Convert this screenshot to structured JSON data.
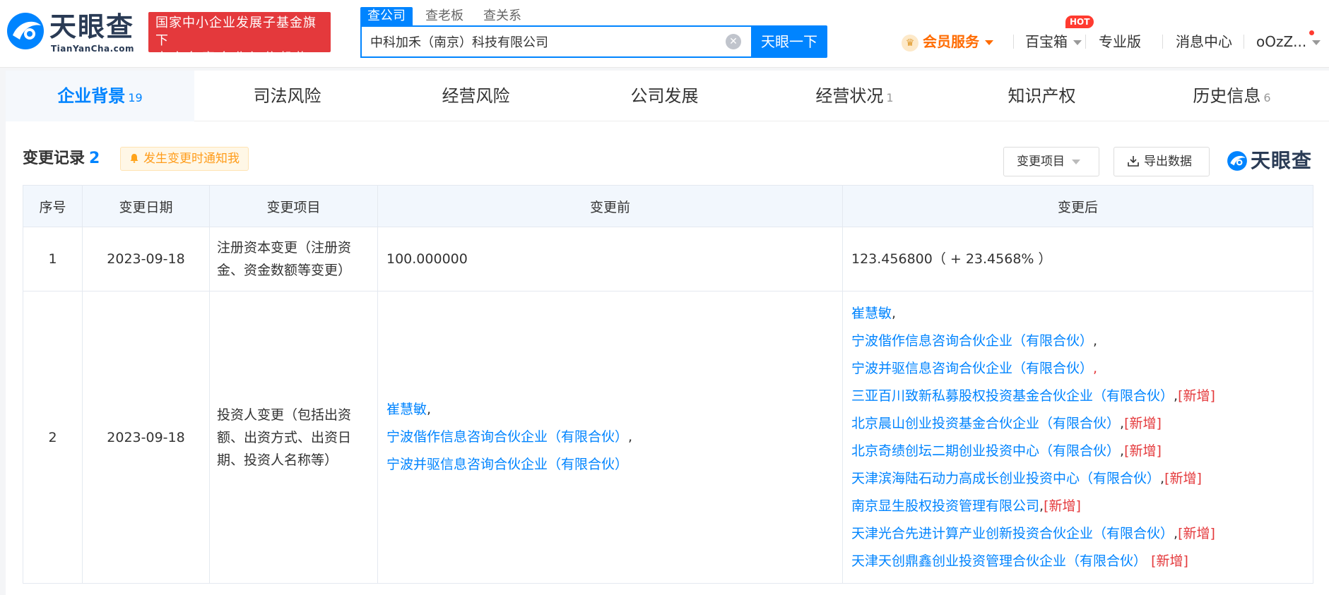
{
  "header": {
    "logo_cn": "天眼查",
    "logo_en": "TianYanCha.com",
    "gov_badge_line1": "国家中小企业发展子基金旗下",
    "gov_badge_line2": "官方备案企业征信机构",
    "search_tabs": [
      "查公司",
      "查老板",
      "查关系"
    ],
    "search_value": "中科加禾（南京）科技有限公司",
    "search_button": "天眼一下",
    "nav": {
      "vip": "会员服务",
      "toolbox": "百宝箱",
      "hot": "HOT",
      "pro": "专业版",
      "messages": "消息中心",
      "user": "oOzZ..."
    }
  },
  "tabs": [
    {
      "label": "企业背景",
      "count": "19"
    },
    {
      "label": "司法风险",
      "count": ""
    },
    {
      "label": "经营风险",
      "count": ""
    },
    {
      "label": "公司发展",
      "count": ""
    },
    {
      "label": "经营状况",
      "count": "1"
    },
    {
      "label": "知识产权",
      "count": ""
    },
    {
      "label": "历史信息",
      "count": "6"
    }
  ],
  "section": {
    "title": "变更记录",
    "count": "2",
    "notify": "发生变更时通知我",
    "filter": "变更项目",
    "export": "导出数据",
    "watermark": "天眼查"
  },
  "table": {
    "headers": [
      "序号",
      "变更日期",
      "变更项目",
      "变更前",
      "变更后"
    ],
    "rows": [
      {
        "index": "1",
        "date": "2023-09-18",
        "item": "注册资本变更（注册资金、资金数额等变更）",
        "before": "100.000000",
        "after": "123.456800（ + 23.4568% ）"
      },
      {
        "index": "2",
        "date": "2023-09-18",
        "item": "投资人变更（包括出资额、出资方式、出资日期、投资人名称等）",
        "before": [
          {
            "name": "崔慧敏",
            "sep": ","
          },
          {
            "name": "宁波偕作信息咨询合伙企业（有限合伙）",
            "sep": ","
          },
          {
            "name": "宁波并驱信息咨询合伙企业（有限合伙）",
            "sep": ""
          }
        ],
        "after": [
          {
            "name": "崔慧敏",
            "sep": ",",
            "tag": ""
          },
          {
            "name": "宁波偕作信息咨询合伙企业（有限合伙）",
            "sep": ",",
            "tag": ""
          },
          {
            "name": "宁波并驱信息咨询合伙企业（有限合伙）",
            "sep": ",",
            "tag": ""
          },
          {
            "name": "三亚百川致新私募股权投资基金合伙企业（有限合伙）",
            "sep": ",",
            "tag": "[新增]"
          },
          {
            "name": "北京晨山创业投资基金合伙企业（有限合伙）",
            "sep": ",",
            "tag": "[新增]"
          },
          {
            "name": "北京奇绩创坛二期创业投资中心（有限合伙）",
            "sep": ",",
            "tag": "[新增]"
          },
          {
            "name": "天津滨海陆石动力高成长创业投资中心（有限合伙）",
            "sep": ",",
            "tag": "[新增]"
          },
          {
            "name": "南京显生股权投资管理有限公司",
            "sep": ",",
            "tag": "[新增]"
          },
          {
            "name": "天津光合先进计算产业创新投资合伙企业（有限合伙）",
            "sep": ",",
            "tag": "[新增]"
          },
          {
            "name": "天津天创鼎鑫创业投资管理合伙企业（有限合伙）",
            "sep": "",
            "tag": "[新增]"
          }
        ]
      }
    ]
  }
}
